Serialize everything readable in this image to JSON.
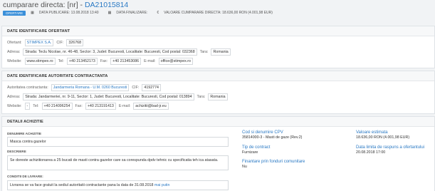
{
  "header": {
    "title_prefix": "cumparare directa: [nr] - ",
    "title_code": "DA21015814",
    "status_badge": "OFERTARE",
    "data_publicare": "DATA PUBLICARE: 13.08.2018 13:40",
    "data_finalizare": "DATA FINALIZARE:",
    "valoare": "VALOARE CUMPARARE DIRECTA: 18.636,00   RON (4.001,98   EUR)"
  },
  "ofertant": {
    "section_title": "DATE IDENTIFICARE OFERTANT",
    "ofertant_label": "Ofertant:",
    "ofertant_value": "STIMPEX S.A.",
    "cif_label": "CIF:",
    "cif_value": "326768",
    "adresa_label": "Adresa:",
    "adresa_value": "Strada: Teclu Nicolae, nr. 46-48, Sector: 3, Judet: Bucuresti, Localitate: Bucuresti, Cod postal: 032368",
    "tara_label": "Tara:",
    "tara_value": "Romania",
    "website_label": "Website:",
    "website_value": "www.stimpex.ro",
    "tel_label": "Tel:",
    "tel_value": "+40 213452173",
    "fax_label": "Fax:",
    "fax_value": "+40 213453086",
    "email_label": "E-mail:",
    "email_value": "office@stimpex.ro"
  },
  "autoritate": {
    "section_title": "DATE IDENTIFICARE AUTORITATE CONTRACTANTA",
    "aut_label": "Autoritatea contractanta:",
    "aut_value": "Jandarmeria Romana - U.M. 0260 Bucuresti",
    "cif_label": "CIF:",
    "cif_value": "4192774",
    "adresa_label": "Adresa:",
    "adresa_value": "Strada: Jandarmeriei, nr. 9-11, Sector: 1, Judet: Bucuresti, Localitate: Bucuresti, Cod postal: 013894",
    "tara_label": "Tara:",
    "tara_value": "Romania",
    "website_label": "Website:",
    "website_value": "-",
    "tel_label": "Tel:",
    "tel_value": "+40 214096254",
    "fax_label": "Fax:",
    "fax_value": "+40 213191413",
    "email_label": "E-mail:",
    "email_value": "achizitii@bad-jr.eu"
  },
  "achizitie": {
    "section_title": "DETALII ACHIZITIE",
    "denumire_label": "DENUMIRE ACHIZITIE",
    "denumire_value": "Masca contra gazelor",
    "descriere_label": "DESCRIERE",
    "descriere_value": "Se doreste achizitionarea a 25 bucati de masti contra gazelor care sa corespunda dpdv tehnic cu specificatia teh ica atasata.",
    "conditii_label": "CONDITII DE LIVRARE:",
    "conditii_value": "Livrarea se va face gratuit la sediul autoritatii contractante pana la data de 31.08.2018",
    "conditii_more": "mai putin",
    "cpv_title": "Cod si denumire CPV",
    "cpv_value": "35814000-3 - Masti de gaze (Rev.2)",
    "tip_title": "Tip de contract",
    "tip_value": "Furnizare",
    "fonduri_title": "Finantare prin fonduri comunitare",
    "fonduri_value": "Nu",
    "valoare_title": "Valoare estimata",
    "valoare_value": "18.636,00   RON (4.001,98   EUR)",
    "termen_title": "Data limita de raspuns a ofertantului",
    "termen_value": "20.08.2018 17:00"
  }
}
